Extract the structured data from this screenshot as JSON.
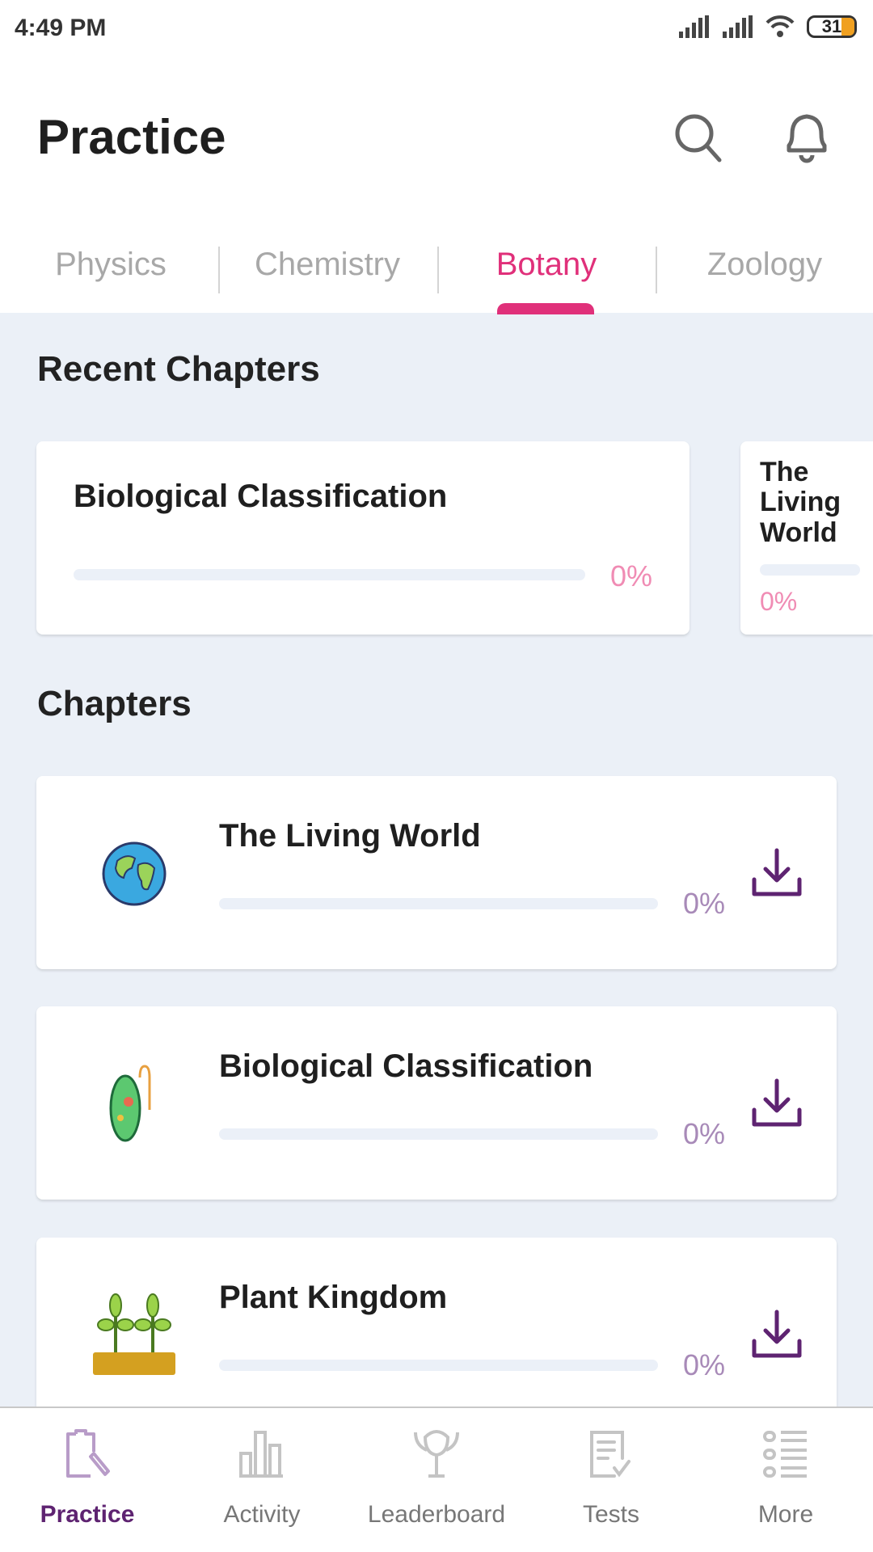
{
  "status_bar": {
    "time": "4:49 PM",
    "battery": "31"
  },
  "header": {
    "title": "Practice",
    "search_icon": "search-icon",
    "bell_icon": "bell-icon"
  },
  "tabs": [
    {
      "label": "Physics"
    },
    {
      "label": "Chemistry"
    },
    {
      "label": "Botany",
      "active": true
    },
    {
      "label": "Zoology"
    }
  ],
  "recent": {
    "heading": "Recent Chapters",
    "cards": [
      {
        "title": "Biological Classification",
        "progress": "0%"
      },
      {
        "title": "The Living World",
        "progress": "0%"
      }
    ]
  },
  "chapters": {
    "heading": "Chapters",
    "items": [
      {
        "title": "The Living World",
        "progress": "0%",
        "icon": "globe-icon"
      },
      {
        "title": "Biological Classification",
        "progress": "0%",
        "icon": "cell-icon"
      },
      {
        "title": "Plant Kingdom",
        "progress": "0%",
        "icon": "plants-icon"
      }
    ]
  },
  "nav": [
    {
      "label": "Practice",
      "active": true
    },
    {
      "label": "Activity"
    },
    {
      "label": "Leaderboard"
    },
    {
      "label": "Tests"
    },
    {
      "label": "More"
    }
  ],
  "colors": {
    "accent": "#e0307a",
    "nav_active": "#5e2371",
    "background": "#ebf0f7"
  }
}
